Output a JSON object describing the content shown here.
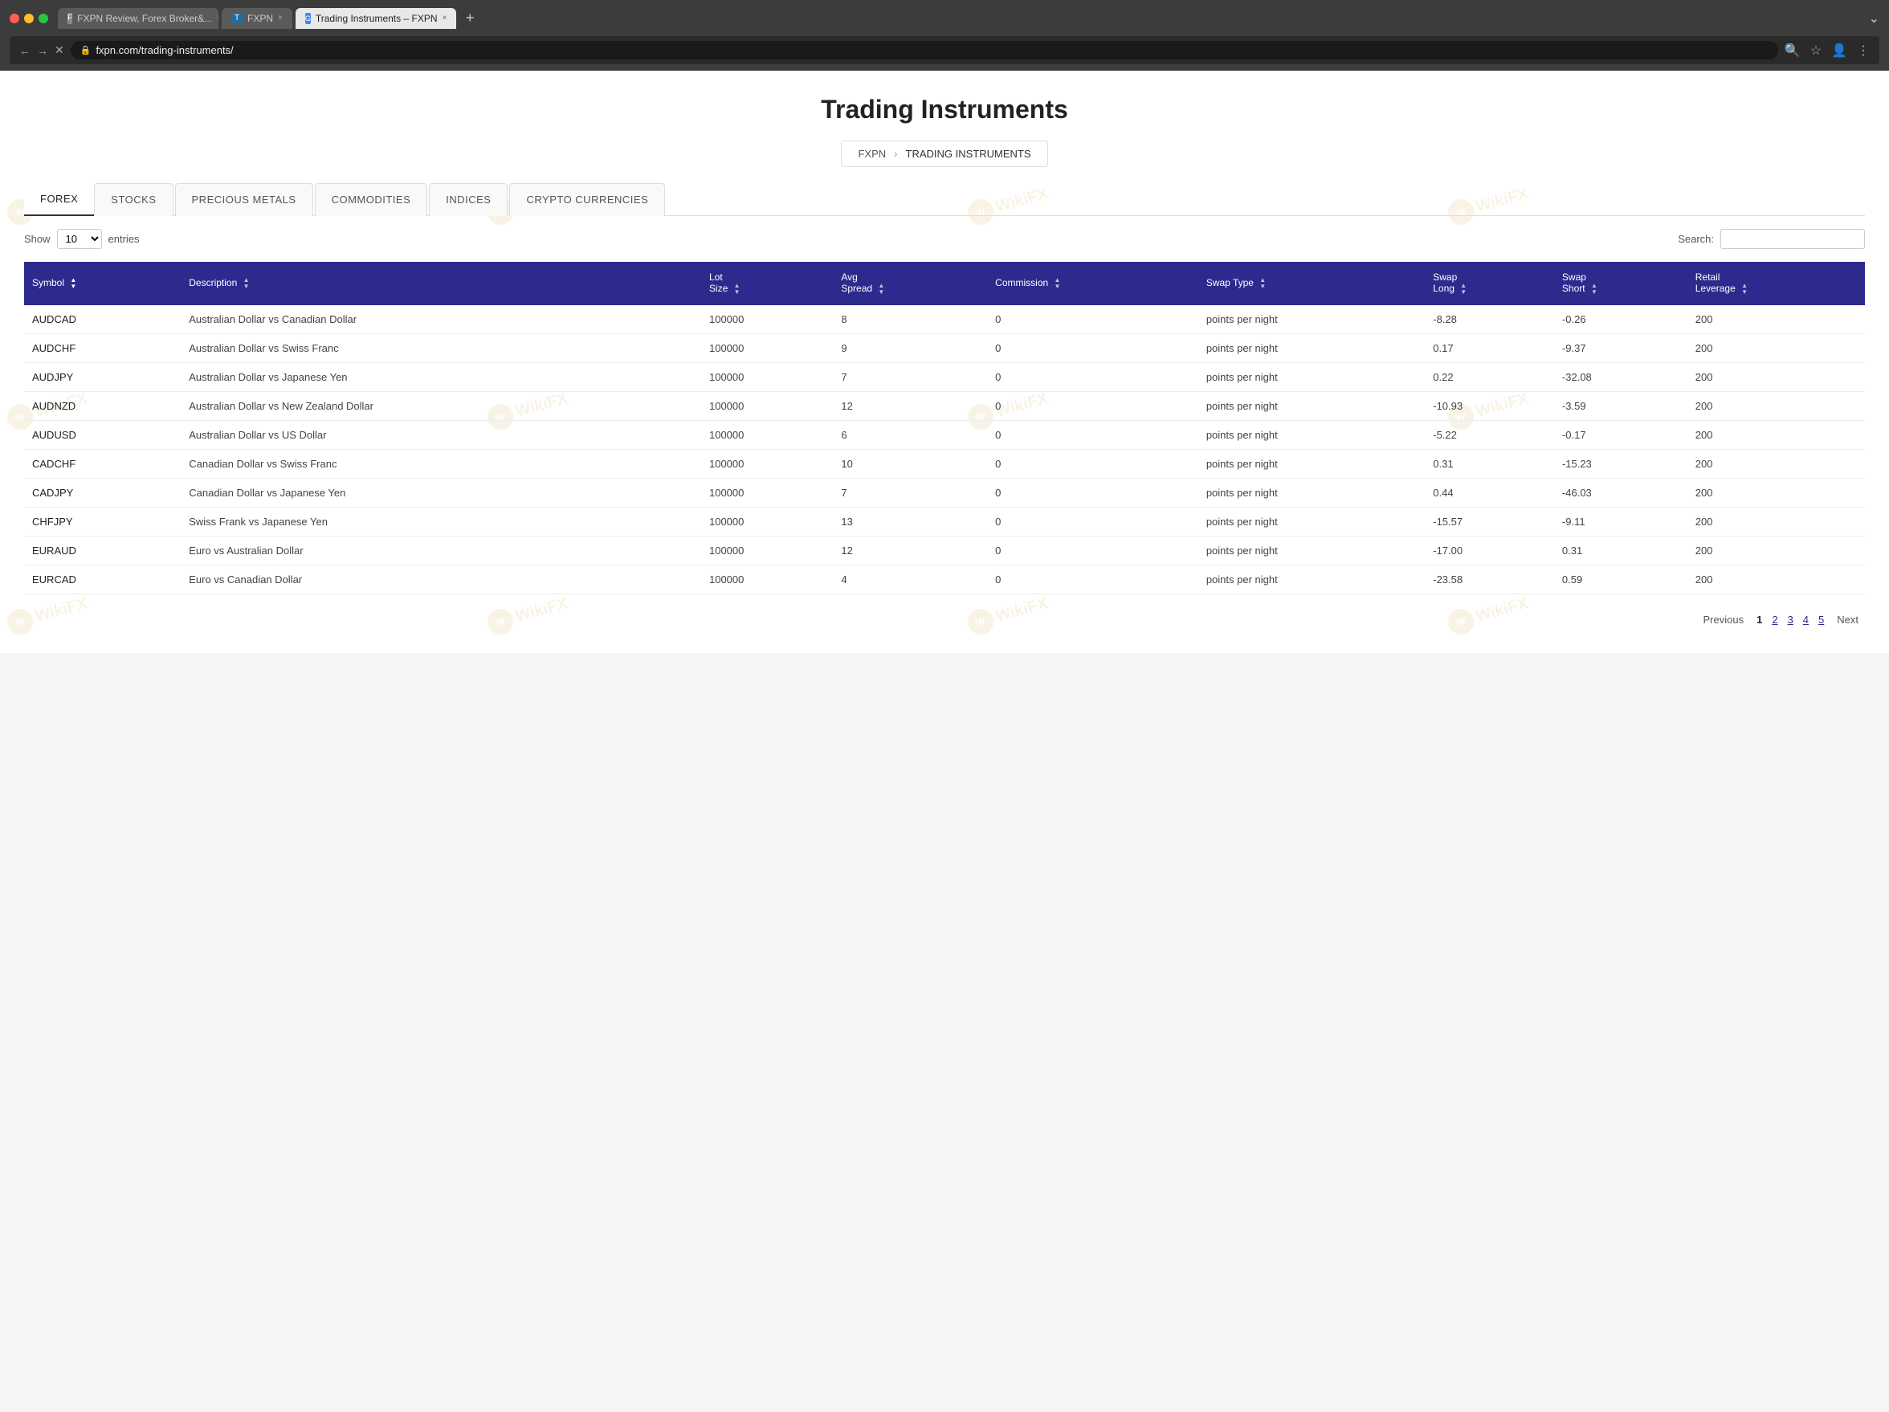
{
  "browser": {
    "tabs": [
      {
        "id": "tab1",
        "label": "FXPN Review, Forex Broker&...",
        "favicon": "F",
        "active": false
      },
      {
        "id": "tab2",
        "label": "FXPN",
        "favicon": "T",
        "active": false
      },
      {
        "id": "tab3",
        "label": "Trading Instruments – FXPN",
        "favicon": "G",
        "active": true
      }
    ],
    "url": "fxpn.com/trading-instruments/"
  },
  "page": {
    "title": "Trading Instruments",
    "breadcrumb": {
      "parent": "FXPN",
      "separator": "›",
      "current": "TRADING INSTRUMENTS"
    }
  },
  "tabs": [
    {
      "id": "forex",
      "label": "FOREX",
      "active": true
    },
    {
      "id": "stocks",
      "label": "STOCKS",
      "active": false
    },
    {
      "id": "precious-metals",
      "label": "PRECIOUS METALS",
      "active": false
    },
    {
      "id": "commodities",
      "label": "COMMODITIES",
      "active": false
    },
    {
      "id": "indices",
      "label": "INDICES",
      "active": false
    },
    {
      "id": "crypto",
      "label": "CRYPTO CURRENCIES",
      "active": false
    }
  ],
  "table": {
    "show_label": "Show",
    "entries_label": "entries",
    "entries_value": "10",
    "search_label": "Search:",
    "columns": [
      {
        "id": "symbol",
        "label": "Symbol",
        "sorted": "asc"
      },
      {
        "id": "description",
        "label": "Description"
      },
      {
        "id": "lot_size",
        "label": "Lot Size"
      },
      {
        "id": "avg_spread",
        "label": "Avg Spread"
      },
      {
        "id": "commission",
        "label": "Commission"
      },
      {
        "id": "swap_type",
        "label": "Swap Type"
      },
      {
        "id": "swap_long",
        "label": "Swap Long"
      },
      {
        "id": "swap_short",
        "label": "Swap Short"
      },
      {
        "id": "retail_leverage",
        "label": "Retail Leverage"
      }
    ],
    "rows": [
      {
        "symbol": "AUDCAD",
        "description": "Australian Dollar vs Canadian Dollar",
        "lot_size": "100000",
        "avg_spread": "8",
        "commission": "0",
        "swap_type": "points per night",
        "swap_long": "-8.28",
        "swap_short": "-0.26",
        "retail_leverage": "200"
      },
      {
        "symbol": "AUDCHF",
        "description": "Australian Dollar vs Swiss Franc",
        "lot_size": "100000",
        "avg_spread": "9",
        "commission": "0",
        "swap_type": "points per night",
        "swap_long": "0.17",
        "swap_short": "-9.37",
        "retail_leverage": "200"
      },
      {
        "symbol": "AUDJPY",
        "description": "Australian Dollar vs Japanese Yen",
        "lot_size": "100000",
        "avg_spread": "7",
        "commission": "0",
        "swap_type": "points per night",
        "swap_long": "0.22",
        "swap_short": "-32.08",
        "retail_leverage": "200"
      },
      {
        "symbol": "AUDNZD",
        "description": "Australian Dollar vs New Zealand Dollar",
        "lot_size": "100000",
        "avg_spread": "12",
        "commission": "0",
        "swap_type": "points per night",
        "swap_long": "-10.93",
        "swap_short": "-3.59",
        "retail_leverage": "200"
      },
      {
        "symbol": "AUDUSD",
        "description": "Australian Dollar vs US Dollar",
        "lot_size": "100000",
        "avg_spread": "6",
        "commission": "0",
        "swap_type": "points per night",
        "swap_long": "-5.22",
        "swap_short": "-0.17",
        "retail_leverage": "200"
      },
      {
        "symbol": "CADCHF",
        "description": "Canadian Dollar vs Swiss Franc",
        "lot_size": "100000",
        "avg_spread": "10",
        "commission": "0",
        "swap_type": "points per night",
        "swap_long": "0.31",
        "swap_short": "-15.23",
        "retail_leverage": "200"
      },
      {
        "symbol": "CADJPY",
        "description": "Canadian Dollar vs Japanese Yen",
        "lot_size": "100000",
        "avg_spread": "7",
        "commission": "0",
        "swap_type": "points per night",
        "swap_long": "0.44",
        "swap_short": "-46.03",
        "retail_leverage": "200"
      },
      {
        "symbol": "CHFJPY",
        "description": "Swiss Frank vs Japanese Yen",
        "lot_size": "100000",
        "avg_spread": "13",
        "commission": "0",
        "swap_type": "points per night",
        "swap_long": "-15.57",
        "swap_short": "-9.11",
        "retail_leverage": "200"
      },
      {
        "symbol": "EURAUD",
        "description": "Euro vs Australian Dollar",
        "lot_size": "100000",
        "avg_spread": "12",
        "commission": "0",
        "swap_type": "points per night",
        "swap_long": "-17.00",
        "swap_short": "0.31",
        "retail_leverage": "200"
      },
      {
        "symbol": "EURCAD",
        "description": "Euro vs Canadian Dollar",
        "lot_size": "100000",
        "avg_spread": "4",
        "commission": "0",
        "swap_type": "points per night",
        "swap_long": "-23.58",
        "swap_short": "0.59",
        "retail_leverage": "200"
      }
    ]
  },
  "pagination": {
    "previous_label": "Previous",
    "next_label": "Next",
    "pages": [
      "1",
      "2",
      "3",
      "4",
      "5"
    ],
    "current_page": "1"
  },
  "watermarks": [
    "WikiFX",
    "WikiFX",
    "WikiFX",
    "WikiFX",
    "WikiFX",
    "WikiFX",
    "WikiFX",
    "WikiFX",
    "WikiFX",
    "WikiFX",
    "WikiFX",
    "WikiFX"
  ]
}
